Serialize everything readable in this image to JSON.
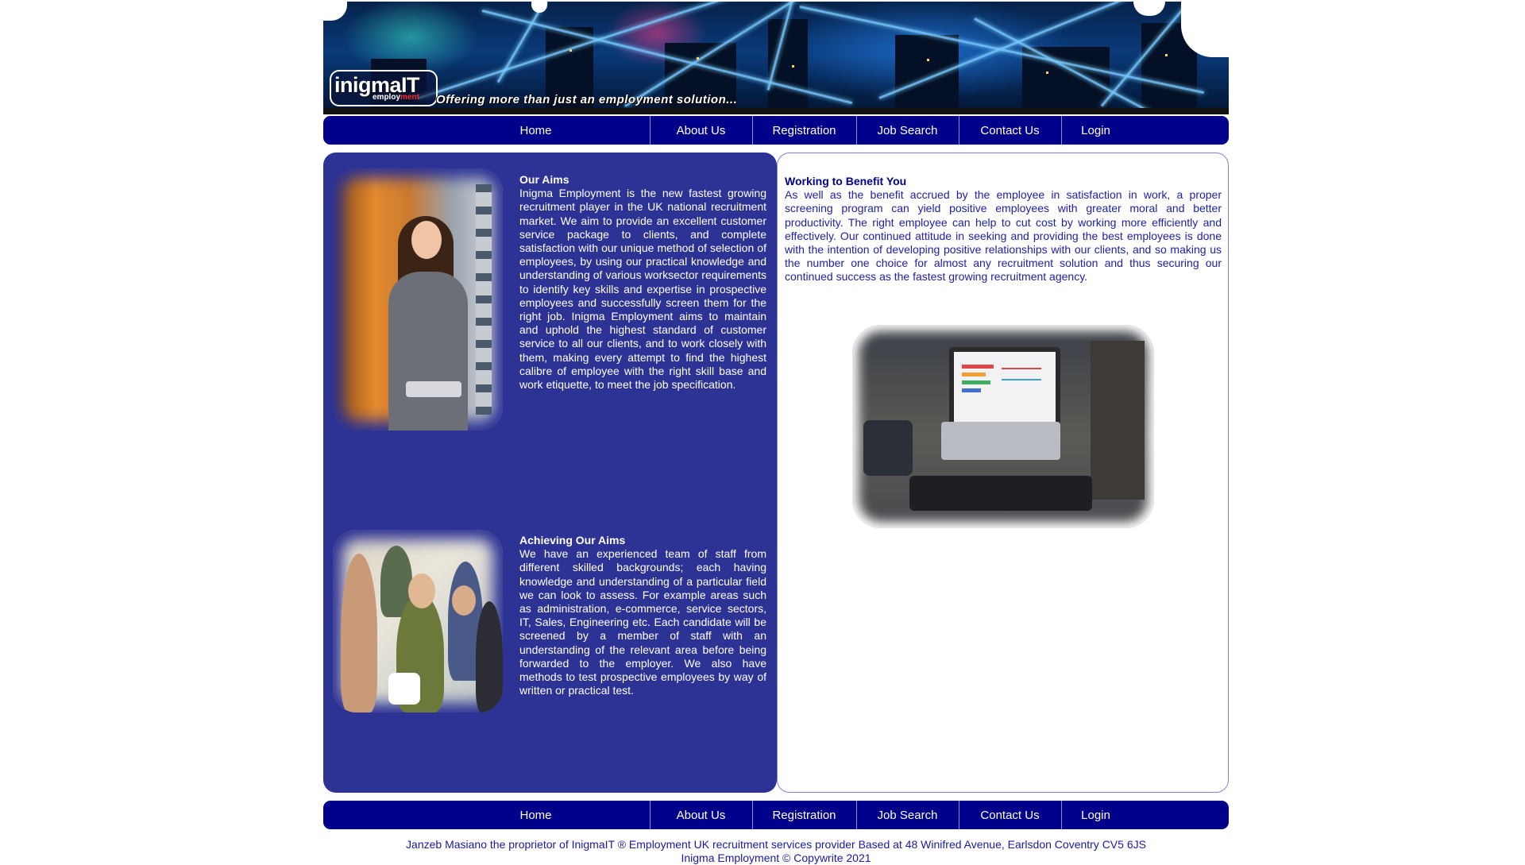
{
  "banner": {
    "logo_text": "inigmaIT",
    "logo_sub_a": "employ",
    "logo_sub_b": "ment",
    "slogan": "Offering more than just an employment solution..."
  },
  "nav": [
    {
      "label": "Home"
    },
    {
      "label": "About Us"
    },
    {
      "label": "Registration"
    },
    {
      "label": "Job Search"
    },
    {
      "label": "Contact Us"
    },
    {
      "label": "Login"
    }
  ],
  "left": {
    "aims_title": "Our Aims",
    "aims_body": "Inigma Employment is the new fastest growing recruitment player in the UK national recruitment market. We aim to provide an excellent customer service package to clients, and complete satisfaction with our unique method of selection of employees, by using our practical knowledge and understanding of various worksector requirements to identify key skills and expertise in prospective employees and successfully screen them for the right job. Inigma Employment aims to maintain and uphold the highest standard of customer service to all our clients, and to work closely with them, making every attempt to find the highest calibre of employee with the right skill base and work etiquette, to meet the job specification.",
    "achieve_title": "Achieving Our Aims",
    "achieve_body": "We have an experienced team of staff from different skilled backgrounds; each having knowledge and understanding of a particular field we can look to assess. For example areas such as administration, e-commerce, service sectors, IT, Sales, Engineering etc. Each candidate will be screened by a member of staff with an understanding of the relevant area before being forwarded to the employer. We also have methods to test prospective employees by way of written or practical test."
  },
  "right": {
    "benefit_title": "Working to Benefit You",
    "benefit_body": "As well as the benefit accrued by the employee in satisfaction in work, a proper screening program can yield positive employees with greater moral and better productivity. The right employee can help to cut cost by working more efficiently and effectively. Our continued attitude in seeking and providing the best employees is done with the intention of developing positive relationships with our clients, and so making us the number one choice for almost any recruitment solution and thus securing our continued success as the fastest growing recruitment agency."
  },
  "footer": {
    "line1": "Janzeb Masiano the proprietor of InigmaIT ® Employment UK recruitment services provider Based at 48 Winifred Avenue, Earlsdon Coventry CV5 6JS",
    "line2": "Inigma Employment © Copywrite 2021"
  },
  "colors": {
    "nav_bg": "#00008b",
    "left_panel_bg": "#2d3394",
    "right_text": "#1a1aa0"
  }
}
